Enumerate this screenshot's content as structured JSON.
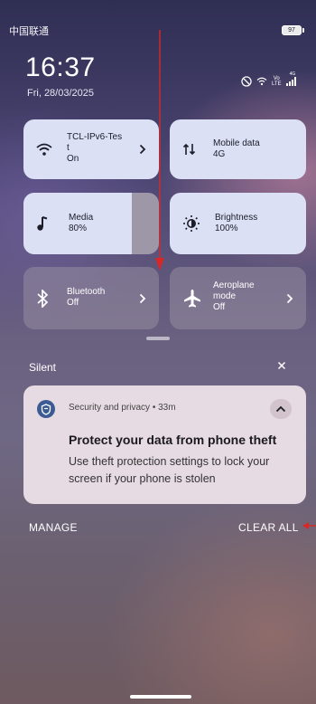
{
  "status_bar": {
    "carrier": "中国联通",
    "battery": "97",
    "volte_top": "Vo",
    "volte_bottom": "LTE",
    "signal_tag": "4G"
  },
  "lock": {
    "time": "16:37",
    "date": "Fri, 28/03/2025"
  },
  "tiles": {
    "wifi": {
      "label": "TCL-IPv6-Tes\nt",
      "status": "On",
      "icon": "wifi-icon"
    },
    "mobile_data": {
      "label": "Mobile data",
      "status": "4G",
      "icon": "mobile-data-icon"
    },
    "media": {
      "label": "Media",
      "status": "80%",
      "level": 0.8,
      "icon": "music-note-icon"
    },
    "brightness": {
      "label": "Brightness",
      "status": "100%",
      "level": 1.0,
      "icon": "brightness-icon"
    },
    "bluetooth": {
      "label": "Bluetooth",
      "status": "Off",
      "icon": "bluetooth-icon"
    },
    "aeroplane": {
      "label": "Aeroplane\nmode",
      "status": "Off",
      "icon": "airplane-icon"
    }
  },
  "notifications": {
    "section_label": "Silent",
    "close_icon": "close-icon",
    "items": [
      {
        "source": "Security and privacy • 33m",
        "title": "Protect your data from phone theft",
        "body": "Use theft protection settings to lock your screen if your phone is stolen",
        "icon": "shield-icon"
      }
    ]
  },
  "actions": {
    "manage": "MANAGE",
    "clear_all": "CLEAR ALL"
  },
  "colors": {
    "tile_active": "#dbe0f5",
    "tile_inactive": "#968ca0",
    "notification_bg": "#e6dbe2",
    "annotation_arrow": "#d62828"
  }
}
